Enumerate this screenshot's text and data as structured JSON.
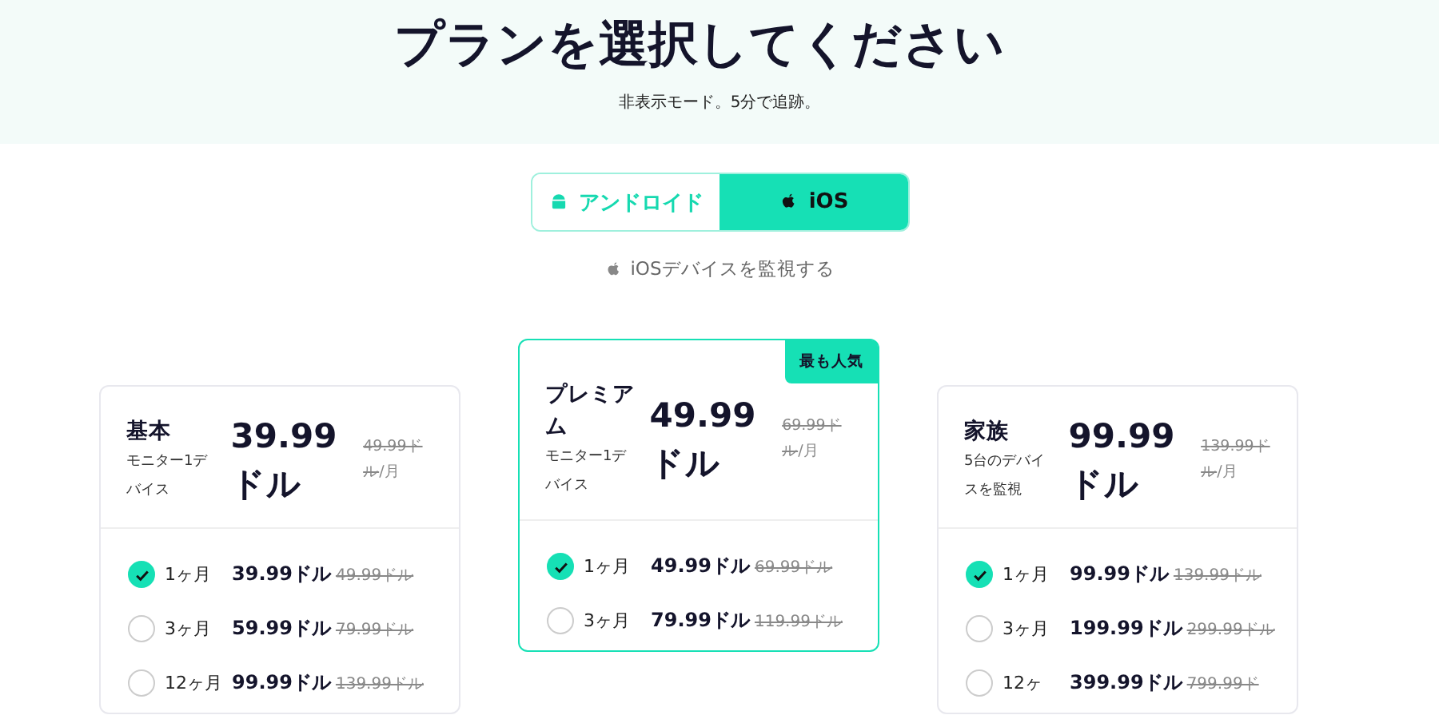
{
  "header": {
    "title": "プランを選択してください",
    "subtitle": "非表示モード。5分で追跡。"
  },
  "platform_tabs": [
    {
      "label": "アンドロイド",
      "kind": "android",
      "selected": false
    },
    {
      "label": "iOS",
      "kind": "apple",
      "selected": true
    }
  ],
  "platform_caption": "iOSデバイスを監視する",
  "plans": [
    {
      "name": "基本",
      "description": "モニター1デバイス",
      "price": "39.99ドル",
      "old_price": "49.99ドル",
      "period": "/月",
      "featured": false,
      "options": [
        {
          "duration": "1ヶ月",
          "price": "39.99ドル",
          "old_price": "49.99ドル",
          "selected": true
        },
        {
          "duration": "3ヶ月",
          "price": "59.99ドル",
          "old_price": "79.99ドル",
          "selected": false
        },
        {
          "duration": "12ヶ月",
          "price": "99.99ドル",
          "old_price": "139.99ドル",
          "selected": false
        }
      ]
    },
    {
      "name": "プレミアム",
      "description": "モニター1デバイス",
      "price": "49.99ドル",
      "old_price": "69.99ドル",
      "period": "/月",
      "featured": true,
      "badge": "最も人気",
      "options": [
        {
          "duration": "1ヶ月",
          "price": "49.99ドル",
          "old_price": "69.99ドル",
          "selected": true
        },
        {
          "duration": "3ヶ月",
          "price": "79.99ドル",
          "old_price": "119.99ドル",
          "selected": false
        }
      ]
    },
    {
      "name": "家族",
      "description": "5台のデバイスを監視",
      "price": "99.99ドル",
      "old_price": "139.99ドル",
      "period": "/月",
      "featured": false,
      "options": [
        {
          "duration": "1ヶ月",
          "price": "99.99ドル",
          "old_price": "139.99ドル",
          "selected": true
        },
        {
          "duration": "3ヶ月",
          "price": "199.99ドル",
          "old_price": "299.99ドル",
          "selected": false
        },
        {
          "duration": "12ヶ",
          "price": "399.99ドル",
          "old_price": "799.99ド",
          "selected": false
        }
      ]
    }
  ]
}
